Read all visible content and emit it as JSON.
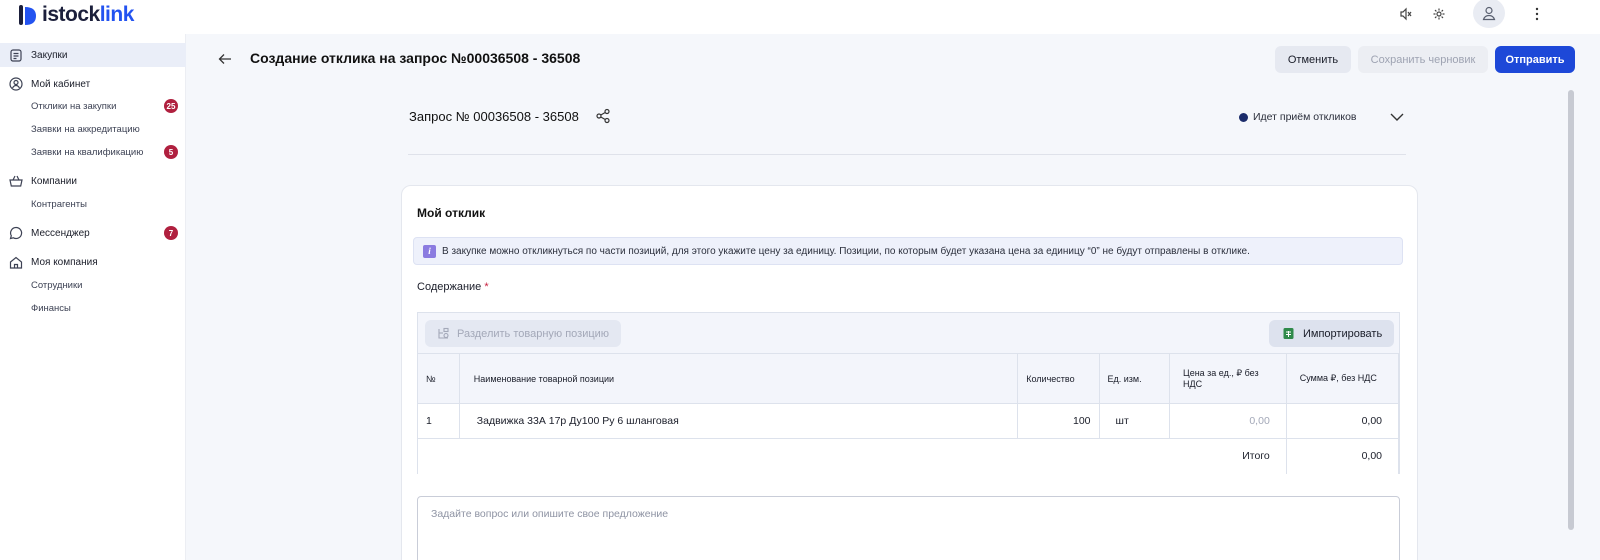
{
  "brand": {
    "part1": "istock",
    "part2": "link",
    "accent": "#2353f0"
  },
  "topbar": {
    "icons": [
      "mute-icon",
      "gear-icon",
      "user-icon",
      "more-vertical-icon"
    ]
  },
  "sidebar": {
    "items": [
      {
        "label": "Закупки",
        "icon": "document-icon",
        "active": true
      },
      {
        "label": "Мой кабинет",
        "icon": "user-circle-icon",
        "children": [
          {
            "label": "Отклики на закупки",
            "badge": "25"
          },
          {
            "label": "Заявки на аккредитацию"
          },
          {
            "label": "Заявки на квалификацию",
            "badge": "5"
          }
        ]
      },
      {
        "label": "Компании",
        "icon": "basket-icon",
        "children": [
          {
            "label": "Контрагенты"
          }
        ]
      },
      {
        "label": "Мессенджер",
        "icon": "chat-icon",
        "badge": "7"
      },
      {
        "label": "Моя компания",
        "icon": "home-icon",
        "children": [
          {
            "label": "Сотрудники"
          },
          {
            "label": "Финансы"
          }
        ]
      }
    ]
  },
  "header": {
    "title": "Создание отклика на запрос №00036508 - 36508",
    "cancel": "Отменить",
    "save_draft": "Сохранить черновик",
    "send": "Отправить"
  },
  "request": {
    "title": "Запрос № 00036508 - 36508",
    "status": "Идет приём откликов",
    "status_color": "#1b2c6b"
  },
  "response": {
    "title": "Мой отклик",
    "info_text": "В закупке можно откликнуться по части позиций, для этого укажите цену за единицу. Позиции, по которым будет указана цена за единицу “0” не будут отправлены в отклике.",
    "content_label": "Содержание",
    "required_mark": "*",
    "split_button": "Разделить товарную позицию",
    "import_button": "Импортировать",
    "columns": [
      "№",
      "Наименование товарной позиции",
      "Количество",
      "Ед. изм.",
      "Цена за ед., ₽ без НДС",
      "Сумма ₽, без НДС"
    ],
    "rows": [
      {
        "no": "1",
        "name": "Задвижка 33А 17р Ду100 Ру 6 шланговая",
        "qty": "100",
        "unit": "шт",
        "price": "0,00",
        "sum": "0,00"
      }
    ],
    "total_label": "Итого",
    "total_value": "0,00",
    "comment_placeholder": "Задайте вопрос или опишите свое предложение"
  }
}
